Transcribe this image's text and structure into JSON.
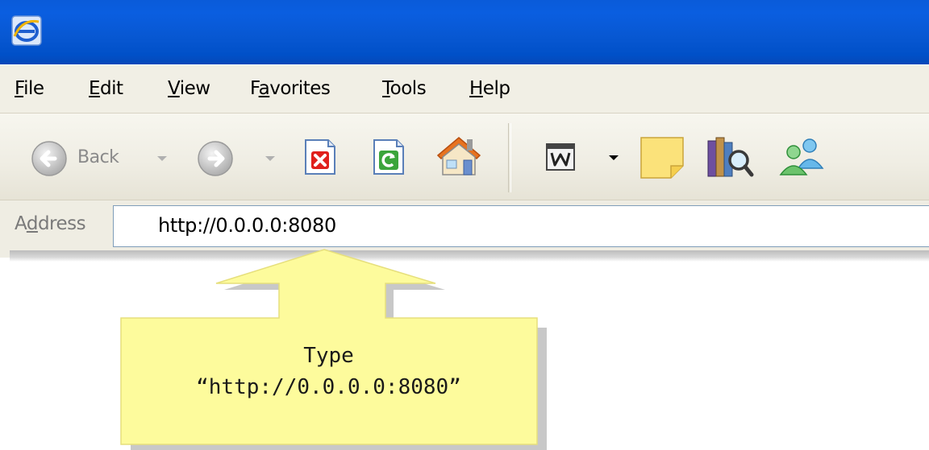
{
  "menu": {
    "file": {
      "pre": "",
      "key": "F",
      "post": "ile"
    },
    "edit": {
      "pre": "",
      "key": "E",
      "post": "dit"
    },
    "view": {
      "pre": "",
      "key": "V",
      "post": "iew"
    },
    "favorites": {
      "pre": "F",
      "key": "a",
      "post": "vorites"
    },
    "tools": {
      "pre": "",
      "key": "T",
      "post": "ools"
    },
    "help": {
      "pre": "",
      "key": "H",
      "post": "elp"
    }
  },
  "toolbar": {
    "back_label": "Back",
    "icons": [
      "back-arrow-icon",
      "forward-arrow-icon",
      "stop-icon",
      "refresh-icon",
      "home-icon",
      "word-icon",
      "note-icon",
      "research-icon",
      "messenger-icon"
    ]
  },
  "address": {
    "label_pre": "A",
    "label_key": "d",
    "label_post": "dress",
    "url": "http://0.0.0.0:8080"
  },
  "callout": {
    "line1": "Type",
    "line2": "“http://0.0.0.0:8080”"
  },
  "colors": {
    "titlebar": "#0a5bd9",
    "callout_fill": "#fdfb9c",
    "callout_border": "#e8e07a"
  }
}
